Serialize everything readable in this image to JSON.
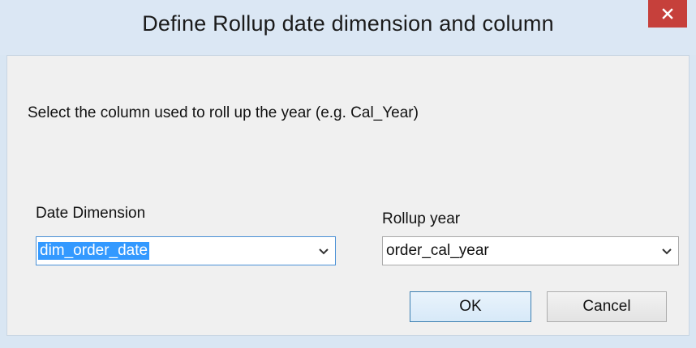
{
  "dialog": {
    "title": "Define Rollup date dimension and column",
    "instruction": "Select the column used to roll up the year (e.g. Cal_Year)",
    "date_dimension": {
      "label": "Date Dimension",
      "value": "dim_order_date"
    },
    "rollup_year": {
      "label": "Rollup year",
      "value": "order_cal_year"
    },
    "ok_label": "OK",
    "cancel_label": "Cancel"
  },
  "colors": {
    "close_button": "#c6403b",
    "title_bar": "#dbe7f4",
    "selection": "#3399ff"
  },
  "icons": {
    "close": "close-icon",
    "dropdown": "chevron-down-icon"
  }
}
